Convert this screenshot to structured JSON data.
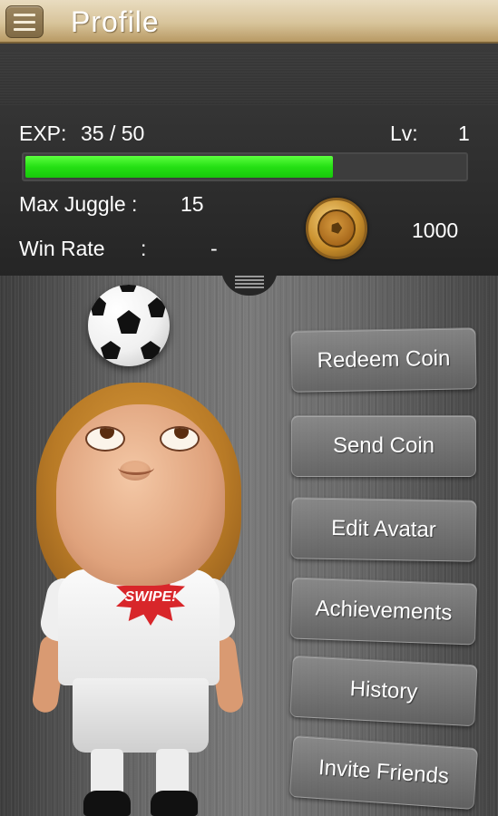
{
  "header": {
    "title": "Profile",
    "menu_icon": "hamburger-menu-icon"
  },
  "stats": {
    "exp_label": "EXP:",
    "exp_value": "35 / 50",
    "exp_progress": 0.7,
    "level_label": "Lv:",
    "level_value": "1",
    "max_juggle_label": "Max Juggle :",
    "max_juggle_value": "15",
    "win_rate_label": "Win Rate",
    "win_rate_colon": ":",
    "win_rate_value": "-",
    "coins": "1000",
    "coin_icon": "gold-coin-icon"
  },
  "avatar": {
    "shirt_logo": "SWIPE!"
  },
  "menu": {
    "redeem_coin": "Redeem Coin",
    "send_coin": "Send Coin",
    "edit_avatar": "Edit Avatar",
    "achievements": "Achievements",
    "history": "History",
    "invite_friends": "Invite Friends"
  },
  "colors": {
    "header_gold": "#d8c49b",
    "exp_green": "#25e014",
    "panel_dark": "#2a2a2a"
  }
}
